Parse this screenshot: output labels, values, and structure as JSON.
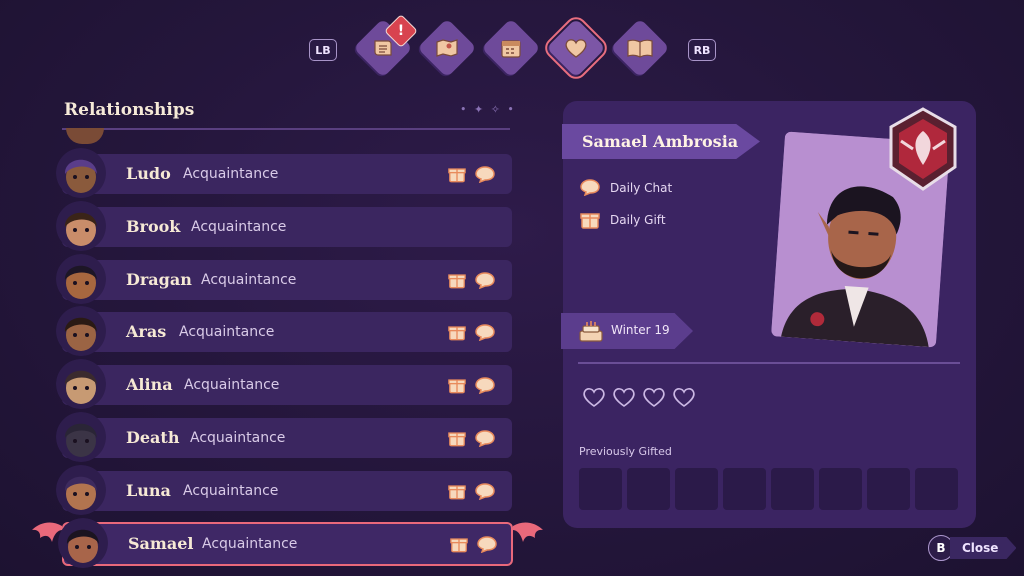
{
  "top_nav": {
    "lb_label": "LB",
    "rb_label": "RB",
    "tabs": [
      {
        "icon": "quest-scroll-icon",
        "has_alert": true
      },
      {
        "icon": "map-icon",
        "has_alert": false
      },
      {
        "icon": "calendar-icon",
        "has_alert": false
      },
      {
        "icon": "heart-icon",
        "active": true
      },
      {
        "icon": "journal-book-icon",
        "has_alert": false
      }
    ],
    "alert_text": "!"
  },
  "relationships": {
    "title": "Relationships",
    "rows": [
      {
        "name": "Ludo",
        "status": "Acquaintance",
        "gift": true,
        "chat": true,
        "skin": "#8a5a3c",
        "hair": "#5a3d8a"
      },
      {
        "name": "Brook",
        "status": "Acquaintance",
        "gift": false,
        "chat": false,
        "skin": "#c98d6a",
        "hair": "#3a2418"
      },
      {
        "name": "Dragan",
        "status": "Acquaintance",
        "gift": true,
        "chat": true,
        "skin": "#a7673f",
        "hair": "#1d1626"
      },
      {
        "name": "Aras",
        "status": "Acquaintance",
        "gift": true,
        "chat": true,
        "skin": "#9b6444",
        "hair": "#2a1a14"
      },
      {
        "name": "Alina",
        "status": "Acquaintance",
        "gift": true,
        "chat": true,
        "skin": "#c79a73",
        "hair": "#3a2a2e"
      },
      {
        "name": "Death",
        "status": "Acquaintance",
        "gift": true,
        "chat": true,
        "skin": "#3b3446",
        "hair": "#2a2536"
      },
      {
        "name": "Luna",
        "status": "Acquaintance",
        "gift": true,
        "chat": true,
        "skin": "#b2744f",
        "hair": "#3d2a5e"
      },
      {
        "name": "Samael",
        "status": "Acquaintance",
        "gift": true,
        "chat": true,
        "selected": true,
        "skin": "#a8654a",
        "hair": "#1b1420"
      }
    ]
  },
  "detail": {
    "name": "Samael Ambrosia",
    "daily_chat": "Daily Chat",
    "daily_gift": "Daily Gift",
    "birthday": "Winter 19",
    "hearts_filled": 0,
    "hearts_total": 4,
    "previously_gifted_label": "Previously Gifted",
    "gift_slots": 8
  },
  "close": {
    "key": "B",
    "label": "Close"
  },
  "colors": {
    "accent": "#e9697b",
    "tan_icon": "#f0c7a3",
    "panel": "#3b2462"
  }
}
